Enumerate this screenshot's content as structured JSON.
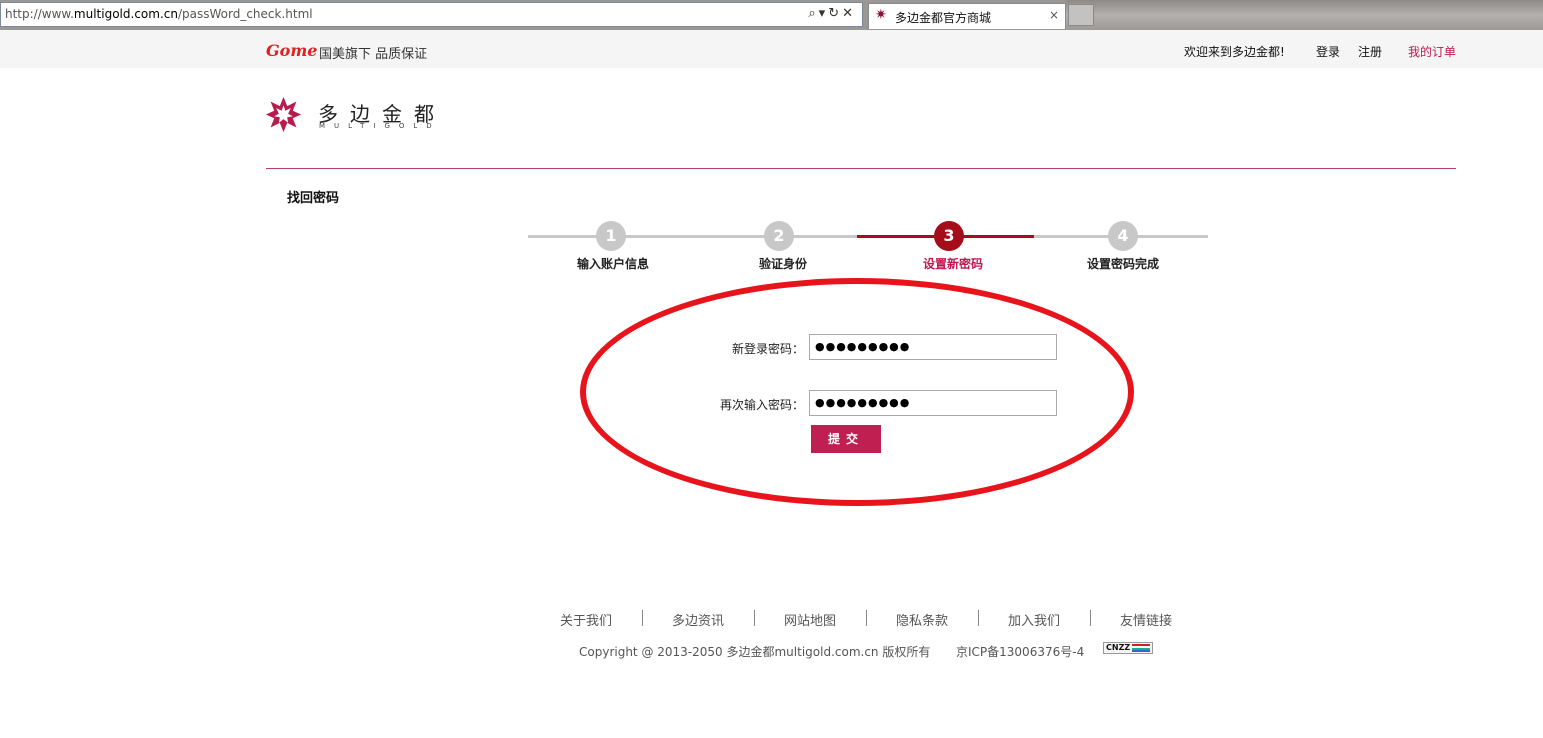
{
  "browser": {
    "url_prefix": "http://www.",
    "url_domain": "multigold.com.cn",
    "url_path": "/passWord_check.html",
    "address_icons": "⌕▾↻✕",
    "tab_title": "多边金都官方商城",
    "tab_close": "×"
  },
  "topbar": {
    "partner_logo": "Gome",
    "slogan": "国美旗下 品质保证",
    "welcome": "欢迎来到多边金都!",
    "login": "登录",
    "register": "注册",
    "my_orders": "我的订单"
  },
  "brand": {
    "name_cn": "多边金都",
    "name_en": "MULTIGOLD",
    "color": "#b81b4e"
  },
  "page": {
    "title": "找回密码"
  },
  "steps": [
    {
      "number": "1",
      "label": "输入账户信息",
      "state": "done"
    },
    {
      "number": "2",
      "label": "验证身份",
      "state": "done"
    },
    {
      "number": "3",
      "label": "设置新密码",
      "state": "active"
    },
    {
      "number": "4",
      "label": "设置密码完成",
      "state": "pending"
    }
  ],
  "form": {
    "new_password_label": "新登录密码：",
    "new_password_value": "●●●●●●●●●",
    "confirm_password_label": "再次输入密码：",
    "confirm_password_value": "●●●●●●●●●",
    "submit_label": "提交"
  },
  "footer": {
    "links": [
      "关于我们",
      "多边资讯",
      "网站地图",
      "隐私条款",
      "加入我们",
      "友情链接"
    ],
    "copyright": "Copyright @ 2013-2050 多边金都multigold.com.cn 版权所有",
    "icp": "京ICP备13006376号-4",
    "badge": "CNZZ"
  },
  "colors": {
    "accent": "#c0174e",
    "active_step": "#a50d1a",
    "inactive_step": "#c8c8c8",
    "annotation": "#e8141c"
  }
}
